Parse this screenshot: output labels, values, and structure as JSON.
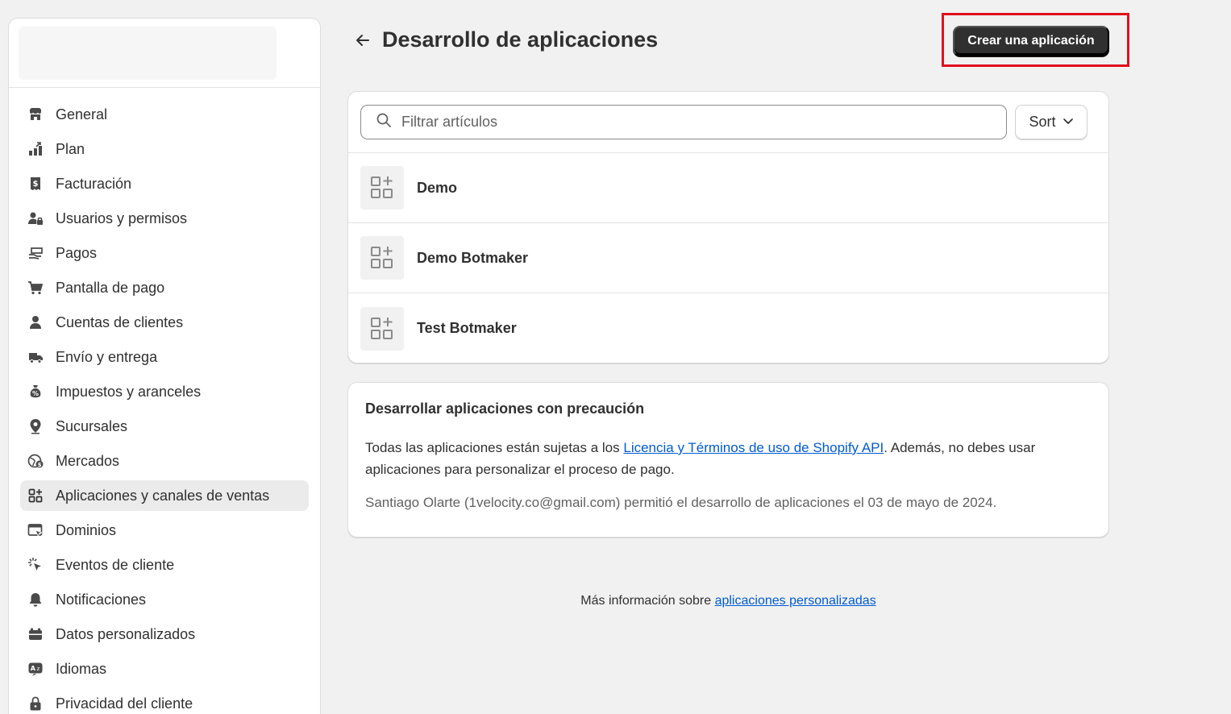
{
  "sidebar": {
    "items": [
      {
        "label": "General",
        "icon": "store-icon"
      },
      {
        "label": "Plan",
        "icon": "plan-icon"
      },
      {
        "label": "Facturación",
        "icon": "receipt-dollar-icon"
      },
      {
        "label": "Usuarios y permisos",
        "icon": "person-lock-icon"
      },
      {
        "label": "Pagos",
        "icon": "cash-hand-icon"
      },
      {
        "label": "Pantalla de pago",
        "icon": "cart-icon"
      },
      {
        "label": "Cuentas de clientes",
        "icon": "person-icon"
      },
      {
        "label": "Envío y entrega",
        "icon": "truck-icon"
      },
      {
        "label": "Impuestos y aranceles",
        "icon": "money-bag-icon"
      },
      {
        "label": "Sucursales",
        "icon": "location-pin-icon"
      },
      {
        "label": "Mercados",
        "icon": "globe-dollar-icon"
      },
      {
        "label": "Aplicaciones y canales de ventas",
        "icon": "apps-icon",
        "active": true
      },
      {
        "label": "Dominios",
        "icon": "domain-icon"
      },
      {
        "label": "Eventos de cliente",
        "icon": "cursor-click-icon"
      },
      {
        "label": "Notificaciones",
        "icon": "bell-icon"
      },
      {
        "label": "Datos personalizados",
        "icon": "database-icon"
      },
      {
        "label": "Idiomas",
        "icon": "translate-icon"
      },
      {
        "label": "Privacidad del cliente",
        "icon": "lock-icon"
      }
    ]
  },
  "header": {
    "title": "Desarrollo de aplicaciones",
    "create_button": "Crear una aplicación"
  },
  "filter": {
    "placeholder": "Filtrar artículos",
    "sort_label": "Sort"
  },
  "apps": [
    {
      "name": "Demo"
    },
    {
      "name": "Demo Botmaker"
    },
    {
      "name": "Test Botmaker"
    }
  ],
  "caution": {
    "title": "Desarrollar aplicaciones con precaución",
    "text_before": "Todas las aplicaciones están sujetas a los ",
    "link": "Licencia y Términos de uso de Shopify API",
    "text_after": ". Además, no debes usar aplicaciones para personalizar el proceso de pago.",
    "meta": "Santiago Olarte (1velocity.co@gmail.com) permitió el desarrollo de aplicaciones el 03 de mayo de 2024."
  },
  "footer": {
    "text": "Más información sobre ",
    "link": "aplicaciones personalizadas"
  },
  "colors": {
    "primary_button": "#303030",
    "link": "#005bd3",
    "highlight": "#e0101e"
  }
}
